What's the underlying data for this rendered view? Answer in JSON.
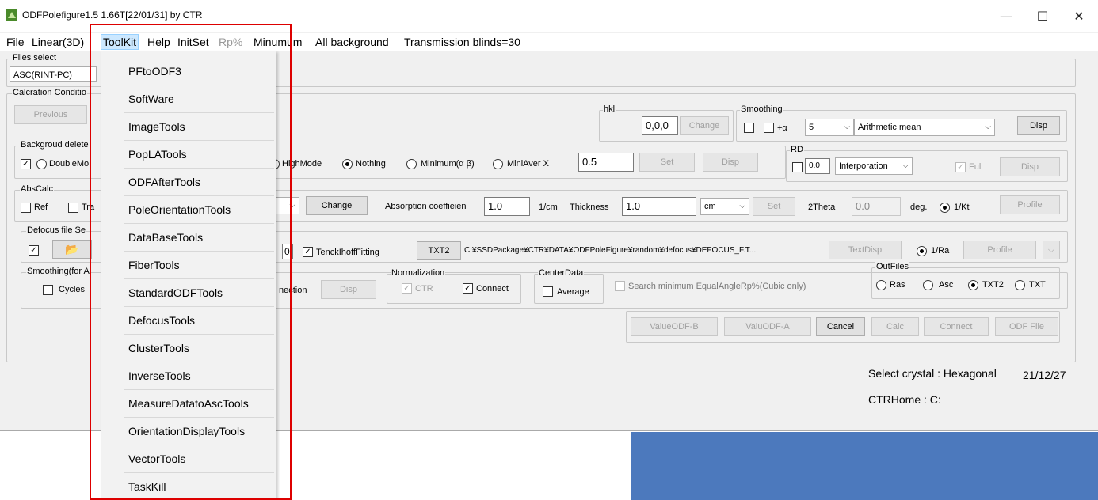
{
  "window": {
    "title": "ODFPolefigure1.5 1.66T[22/01/31] by CTR",
    "minimize": "—",
    "maximize": "☐",
    "close": "✕"
  },
  "menubar": {
    "items": [
      {
        "label": "File"
      },
      {
        "label": "Linear(3D)"
      },
      {
        "label": "ToolKit"
      },
      {
        "label": "Help"
      },
      {
        "label": "InitSet"
      },
      {
        "label": "Rp%"
      },
      {
        "label": "Minumum"
      },
      {
        "label": "All background"
      },
      {
        "label": "Transmission blinds=30"
      }
    ]
  },
  "dropdown": {
    "items": [
      "PFtoODF3",
      "SoftWare",
      "ImageTools",
      "PopLATools",
      "ODFAfterTools",
      "PoleOrientationTools",
      "DataBaseTools",
      "FiberTools",
      "StandardODFTools",
      "DefocusTools",
      "ClusterTools",
      "InverseTools",
      "MeasureDatatoAscTools",
      "OrientationDisplayTools",
      "VectorTools",
      "TaskKill"
    ]
  },
  "files_select": {
    "legend": "Files select",
    "value": "ASC(RINT-PC)"
  },
  "calc": {
    "legend": "Calcration Conditio",
    "previous": "Previous",
    "hkl_legend": "hkl",
    "hkl_value": "0,0,0",
    "change": "Change",
    "smoothing_legend": "Smoothing",
    "plus_alpha": "+α",
    "smooth_n": "5",
    "smooth_method": "Arithmetic mean",
    "disp": "Disp"
  },
  "background": {
    "legend": "Backgroud delete",
    "double": "DoubleMo",
    "highmode": "HighMode",
    "nothing": "Nothing",
    "minimum": "Minimum(α β)",
    "miniaver": "MiniAver X",
    "value": "0.5",
    "set": "Set",
    "disp": "Disp",
    "rd_legend": "RD",
    "rd_value": "0.0",
    "interp": "Interporation",
    "full": "Full",
    "rd_disp": "Disp"
  },
  "abscalc": {
    "legend": "AbsCalc",
    "ref": "Ref",
    "tra": "Tra",
    "change": "Change",
    "abs_label": "Absorption coeffieien",
    "abs_value": "1.0",
    "abs_unit": "1/cm",
    "thick_label": "Thickness",
    "thick_value": "1.0",
    "thick_unit": "cm",
    "set": "Set",
    "twotheta": "2Theta",
    "twotheta_value": "0.0",
    "deg": "deg.",
    "kt": "1/Kt",
    "profile": "Profile"
  },
  "defocus": {
    "legend": "Defocus file Se",
    "zero": "0",
    "tenck": "TenckIhoffFitting",
    "txt2": "TXT2",
    "path": "C:¥SSDPackage¥CTR¥DATA¥ODFPoleFigure¥random¥defocus¥DEFOCUS_F.T...",
    "textdisp": "TextDisp",
    "ra": "1/Ra",
    "profile": "Profile"
  },
  "smoothing_for": {
    "legend": "Smoothing(for A",
    "cycles": "Cycles",
    "nection": "nection",
    "disp": "Disp",
    "norm_legend": "Normalization",
    "ctr": "CTR",
    "connect": "Connect",
    "center_legend": "CenterData",
    "average": "Average",
    "search": "Search minimum EqualAngleRp%(Cubic only)",
    "outfiles_legend": "OutFiles",
    "ras": "Ras",
    "asc": "Asc",
    "txt2": "TXT2",
    "txt": "TXT"
  },
  "actions": {
    "value_odf_b": "ValueODF-B",
    "valu_odf_a": "ValuODF-A",
    "cancel": "Cancel",
    "calc": "Calc",
    "connect": "Connect",
    "odf_file": "ODF File"
  },
  "status": {
    "crystal_label": "Select crystal : Hexagonal",
    "date": "21/12/27",
    "home": "CTRHome : C:"
  },
  "colors": {
    "highlight": "#cce8ff",
    "annotation": "#dd0000",
    "desktop": "#4c79bd"
  }
}
